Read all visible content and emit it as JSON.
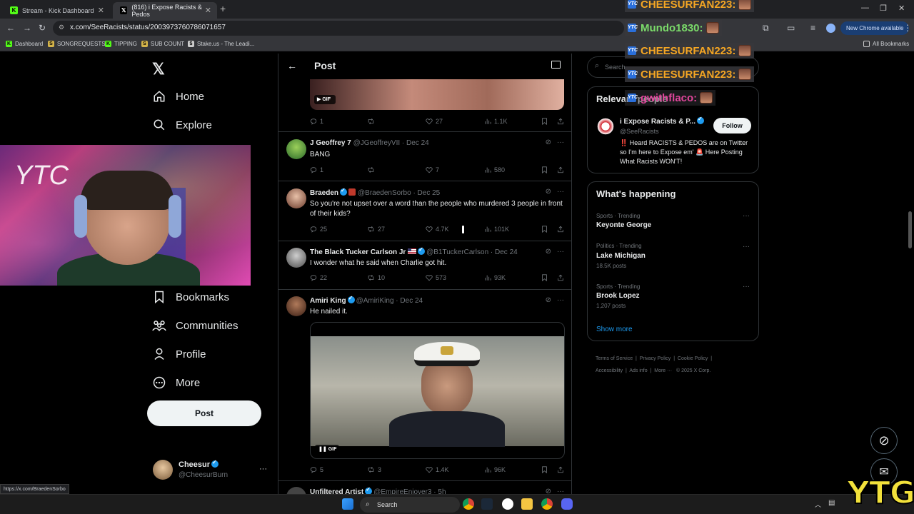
{
  "browser": {
    "tabs": [
      {
        "label": "Stream - Kick Dashboard",
        "icon": "kick-icon"
      },
      {
        "label": "(816) i Expose Racists & Pedos",
        "icon": "x-logo-icon"
      }
    ],
    "url": "x.com/SeeRacists/status/2003973760786071657",
    "new_chrome": "New Chrome available",
    "bookmarks": [
      "Dashboard",
      "SONGREQUESTS",
      "TIPPING",
      "SUB COUNT",
      "Stake.us - The Leadi...",
      "All Bookmarks"
    ],
    "status_url": "https://x.com/BraedenSorbo"
  },
  "nav": {
    "items": [
      "Home",
      "Explore",
      "Bookmarks",
      "Communities",
      "Profile",
      "More"
    ],
    "post_button": "Post",
    "account": {
      "name": "Cheesur",
      "handle": "@CheesurBurn"
    }
  },
  "header": {
    "title": "Post"
  },
  "gif_label": "GIF",
  "tweets": [
    {
      "name": "",
      "handle": "",
      "date": "",
      "text": "",
      "stats": {
        "replies": "1",
        "reposts": "",
        "likes": "27",
        "views": "1.1K"
      }
    },
    {
      "name": "J Geoffrey 7",
      "handle": "@JGeoffreyVII",
      "date": "· Dec 24",
      "text": "BANG",
      "stats": {
        "replies": "1",
        "reposts": "",
        "likes": "7",
        "views": "580"
      }
    },
    {
      "name": "Braeden",
      "handle": "@BraedenSorbo",
      "date": "· Dec 25",
      "text": "So you're not upset over a word than the people who murdered 3 people in front of their kids?",
      "stats": {
        "replies": "25",
        "reposts": "27",
        "likes": "4.7K",
        "views": "101K"
      }
    },
    {
      "name": "The Black Tucker Carlson Jr",
      "handle": "@B1TuckerCarlson",
      "date": "· Dec 24",
      "text": "I wonder what he said when Charlie got hit.",
      "stats": {
        "replies": "22",
        "reposts": "10",
        "likes": "573",
        "views": "93K"
      }
    },
    {
      "name": "Amiri King",
      "handle": "@AmiriKing",
      "date": "· Dec 24",
      "text": "He nailed it.",
      "stats": {
        "replies": "5",
        "reposts": "3",
        "likes": "1.4K",
        "views": "96K"
      }
    },
    {
      "name": "Unfiltered Artist",
      "handle": "@EmpireEnjoyer3",
      "date": "· 5h",
      "text": "",
      "stats": {}
    }
  ],
  "right": {
    "search_placeholder": "Search",
    "relevant": {
      "title": "Relevant people",
      "name": "i Expose Racists & P...",
      "handle": "@SeeRacists",
      "follow": "Follow",
      "bio": "‼️ Heard RACISTS & PEDOS are on Twitter so I'm here to Expose em' 🚨 Here Posting What Racists WON'T!"
    },
    "happening": {
      "title": "What's happening",
      "trends": [
        {
          "meta": "Sports · Trending",
          "name": "Keyonte George",
          "posts": ""
        },
        {
          "meta": "Politics · Trending",
          "name": "Lake Michigan",
          "posts": "18.5K posts"
        },
        {
          "meta": "Sports · Trending",
          "name": "Brook Lopez",
          "posts": "1,207 posts"
        }
      ],
      "show_more": "Show more"
    },
    "footer": [
      "Terms of Service",
      "Privacy Policy",
      "Cookie Policy",
      "Accessibility",
      "Ads info",
      "More ···",
      "© 2025 X Corp."
    ]
  },
  "chat": [
    {
      "user": "CHEESURFAN223:",
      "color": "#f5a623"
    },
    {
      "user": "Mundo1830:",
      "color": "#7bdc6a"
    },
    {
      "user": "CHEESURFAN223:",
      "color": "#f5a623"
    },
    {
      "user": "CHEESURFAN223:",
      "color": "#f5a623"
    },
    {
      "user": "gwithflaco:",
      "color": "#e0469b"
    }
  ],
  "taskbar": {
    "search": "Search"
  },
  "overlay": {
    "watermark": "YTG",
    "webcam_text": "YTC"
  }
}
